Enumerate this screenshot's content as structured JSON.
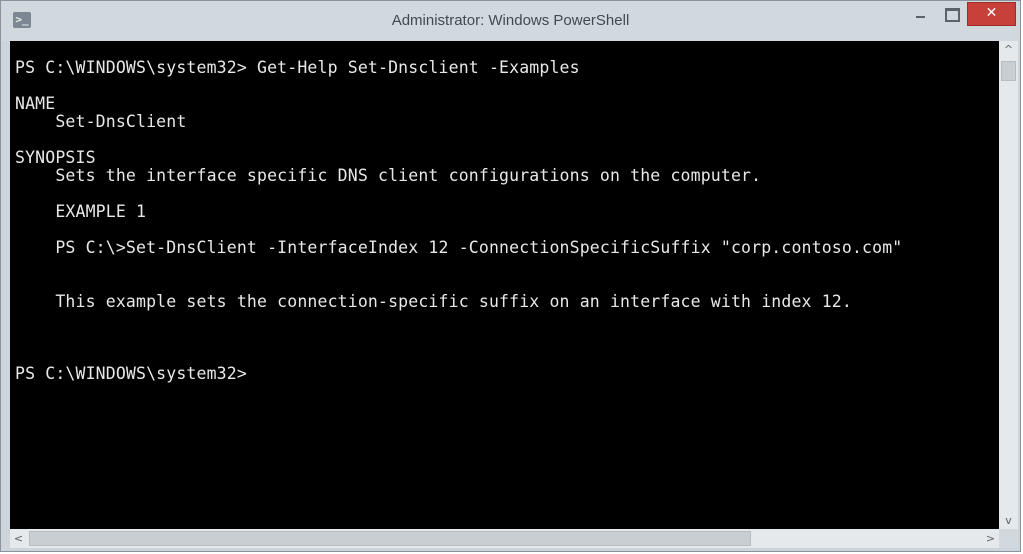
{
  "window": {
    "title": "Administrator: Windows PowerShell",
    "icon": "powershell-icon",
    "controls": {
      "minimize_icon": "minimize-icon",
      "maximize_icon": "maximize-icon",
      "close_label": "✕"
    }
  },
  "console": {
    "background": "#000000",
    "foreground": "#e8e8e8",
    "lines": [
      "PS C:\\WINDOWS\\system32> Get-Help Set-Dnsclient -Examples",
      "NAME",
      "    Set-DnsClient",
      "SYNOPSIS",
      "    Sets the interface specific DNS client configurations on the computer.",
      "    EXAMPLE 1",
      "    PS C:\\>Set-DnsClient -InterfaceIndex 12 -ConnectionSpecificSuffix \"corp.contoso.com\"",
      "    This example sets the connection-specific suffix on an interface with index 12.",
      "PS C:\\WINDOWS\\system32>"
    ]
  },
  "scrollbars": {
    "up_arrow": "^",
    "down_arrow": "v",
    "left_arrow": "<",
    "right_arrow": ">"
  }
}
